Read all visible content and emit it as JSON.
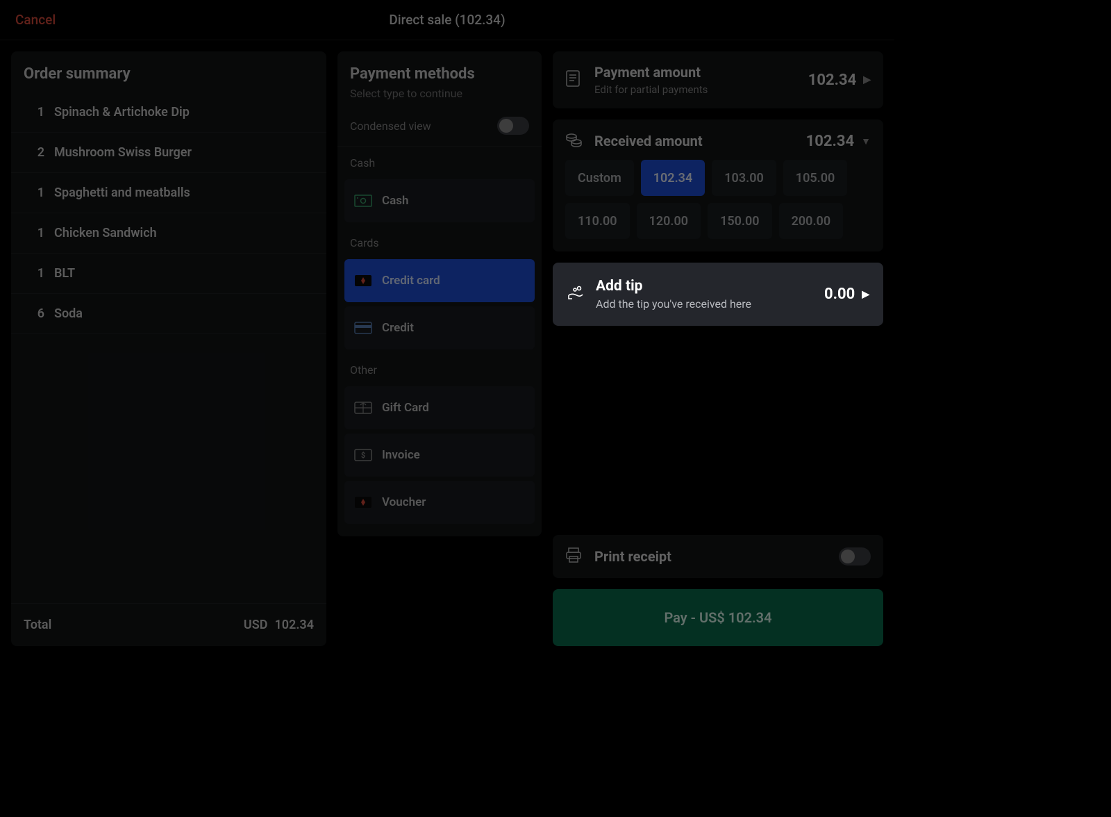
{
  "header": {
    "cancel": "Cancel",
    "title": "Direct sale (102.34)"
  },
  "order": {
    "title": "Order summary",
    "items": [
      {
        "qty": "1",
        "name": "Spinach & Artichoke Dip"
      },
      {
        "qty": "2",
        "name": "Mushroom Swiss Burger"
      },
      {
        "qty": "1",
        "name": "Spaghetti and meatballs"
      },
      {
        "qty": "1",
        "name": "Chicken Sandwich"
      },
      {
        "qty": "1",
        "name": "BLT"
      },
      {
        "qty": "6",
        "name": "Soda"
      }
    ],
    "total_label": "Total",
    "currency": "USD",
    "total_value": "102.34"
  },
  "methods": {
    "title": "Payment methods",
    "subtitle": "Select type to continue",
    "condensed_label": "Condensed view",
    "condensed_on": false,
    "groups": {
      "cash": "Cash",
      "cards": "Cards",
      "other": "Other"
    },
    "cash": {
      "label": "Cash"
    },
    "credit_card": {
      "label": "Credit card",
      "selected": true
    },
    "credit": {
      "label": "Credit"
    },
    "gift_card": {
      "label": "Gift Card"
    },
    "invoice": {
      "label": "Invoice"
    },
    "voucher": {
      "label": "Voucher"
    }
  },
  "payment_amount": {
    "title": "Payment amount",
    "subtitle": "Edit for partial payments",
    "value": "102.34"
  },
  "received": {
    "title": "Received amount",
    "value": "102.34",
    "buttons": [
      {
        "label": "Custom",
        "selected": false
      },
      {
        "label": "102.34",
        "selected": true
      },
      {
        "label": "103.00",
        "selected": false
      },
      {
        "label": "105.00",
        "selected": false
      },
      {
        "label": "110.00",
        "selected": false
      },
      {
        "label": "120.00",
        "selected": false
      },
      {
        "label": "150.00",
        "selected": false
      },
      {
        "label": "200.00",
        "selected": false
      }
    ]
  },
  "tip": {
    "title": "Add tip",
    "subtitle": "Add the tip you've received here",
    "value": "0.00"
  },
  "print": {
    "label": "Print receipt",
    "on": false
  },
  "pay": {
    "label": "Pay - US$ 102.34"
  }
}
